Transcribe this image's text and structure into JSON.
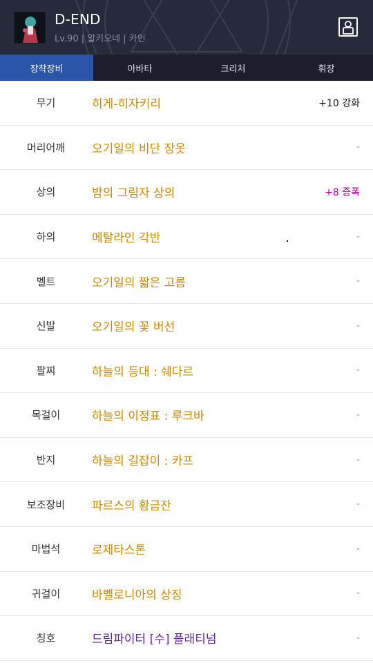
{
  "header": {
    "name": "D-END",
    "subtitle": "Lv.90 | 알키오네 | 카인"
  },
  "tabs": [
    {
      "label": "장착장비",
      "active": true
    },
    {
      "label": "아바타",
      "active": false
    },
    {
      "label": "크리처",
      "active": false
    },
    {
      "label": "휘장",
      "active": false
    }
  ],
  "equipment": [
    {
      "slot": "무기",
      "item": "히게-히자키리",
      "extra": "+10 강화"
    },
    {
      "slot": "머리어깨",
      "item": "오기일의 비단 장옷",
      "extra": "-"
    },
    {
      "slot": "상의",
      "item": "밤의 그림자 상의",
      "extra": "+8 증폭"
    },
    {
      "slot": "하의",
      "item": "메탈라인 각반",
      "extra": "-"
    },
    {
      "slot": "벨트",
      "item": "오기일의 짧은 고름",
      "extra": "-"
    },
    {
      "slot": "신발",
      "item": "오기일의 꽃 버선",
      "extra": "-"
    },
    {
      "slot": "팔찌",
      "item": "하늘의 등대 : 쉐다르",
      "extra": "-"
    },
    {
      "slot": "목걸이",
      "item": "하늘의 이정표 : 루크바",
      "extra": "-"
    },
    {
      "slot": "반지",
      "item": "하늘의 길잡이 : 카프",
      "extra": "-"
    },
    {
      "slot": "보조장비",
      "item": "파르스의 황금잔",
      "extra": "-"
    },
    {
      "slot": "마법석",
      "item": "로제타스톤",
      "extra": "-"
    },
    {
      "slot": "귀걸이",
      "item": "바벨로니아의 상징",
      "extra": "-"
    },
    {
      "slot": "칭호",
      "item": "드림파이터 [수] 플래티넘",
      "extra": "-"
    }
  ],
  "colors": {
    "header_bg": "#262a3a",
    "tab_active": "#2b55a8",
    "item_gold": "#c88a00",
    "item_purple": "#5a1fa0",
    "amplify_magenta": "#b0009c"
  }
}
